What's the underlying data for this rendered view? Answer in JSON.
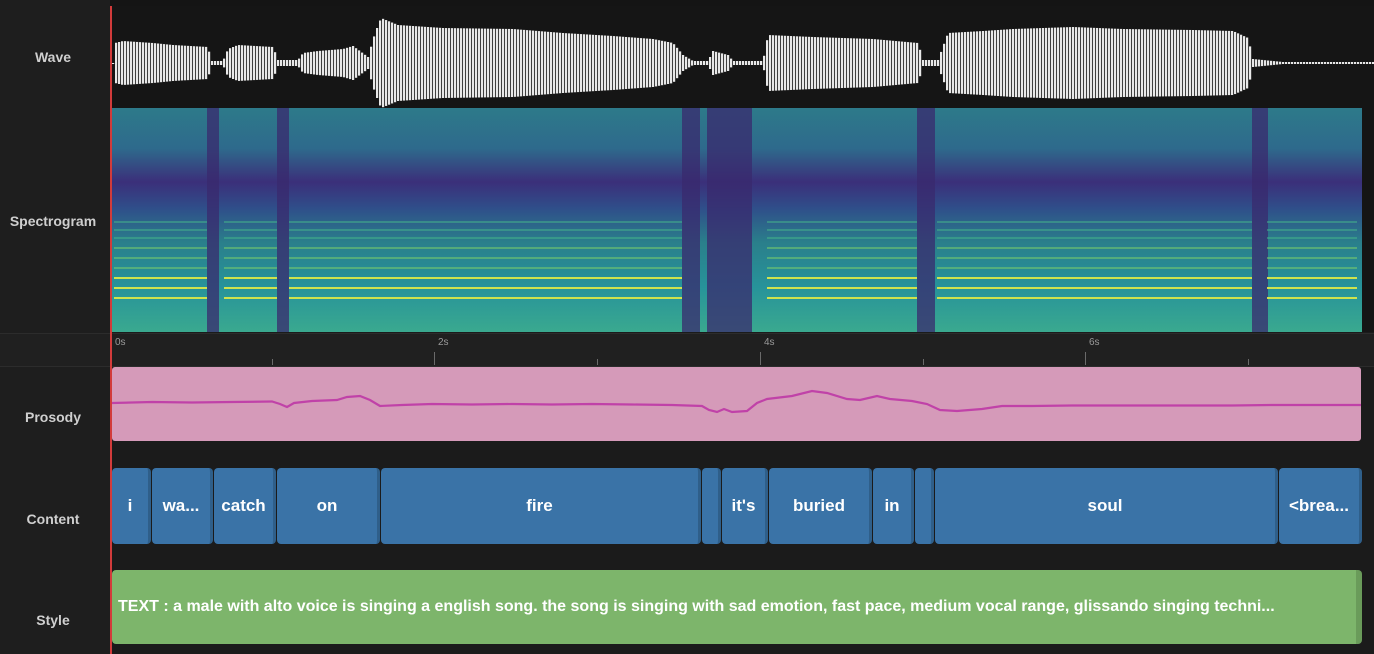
{
  "rows": {
    "wave": "Wave",
    "spectrogram": "Spectrogram",
    "prosody": "Prosody",
    "content": "Content",
    "style": "Style"
  },
  "ruler": {
    "labels": [
      "0s",
      "2s",
      "4s",
      "6s"
    ]
  },
  "content_segments": [
    "i",
    "wa...",
    "catch",
    "on",
    "fire",
    "",
    "it's",
    "buried",
    "in",
    "",
    "soul",
    "<brea..."
  ],
  "style_text": "TEXT : a male with alto voice is singing a english song. the song is singing with sad emotion, fast pace, medium vocal range, glissando singing techni...",
  "colors": {
    "playhead": "#d23b3b",
    "prosody_fill": "#d59ab9",
    "prosody_line": "#c042a8",
    "content_fill": "#3a73a7",
    "style_fill": "#7db56b",
    "waveform": "#e8e8e8"
  }
}
